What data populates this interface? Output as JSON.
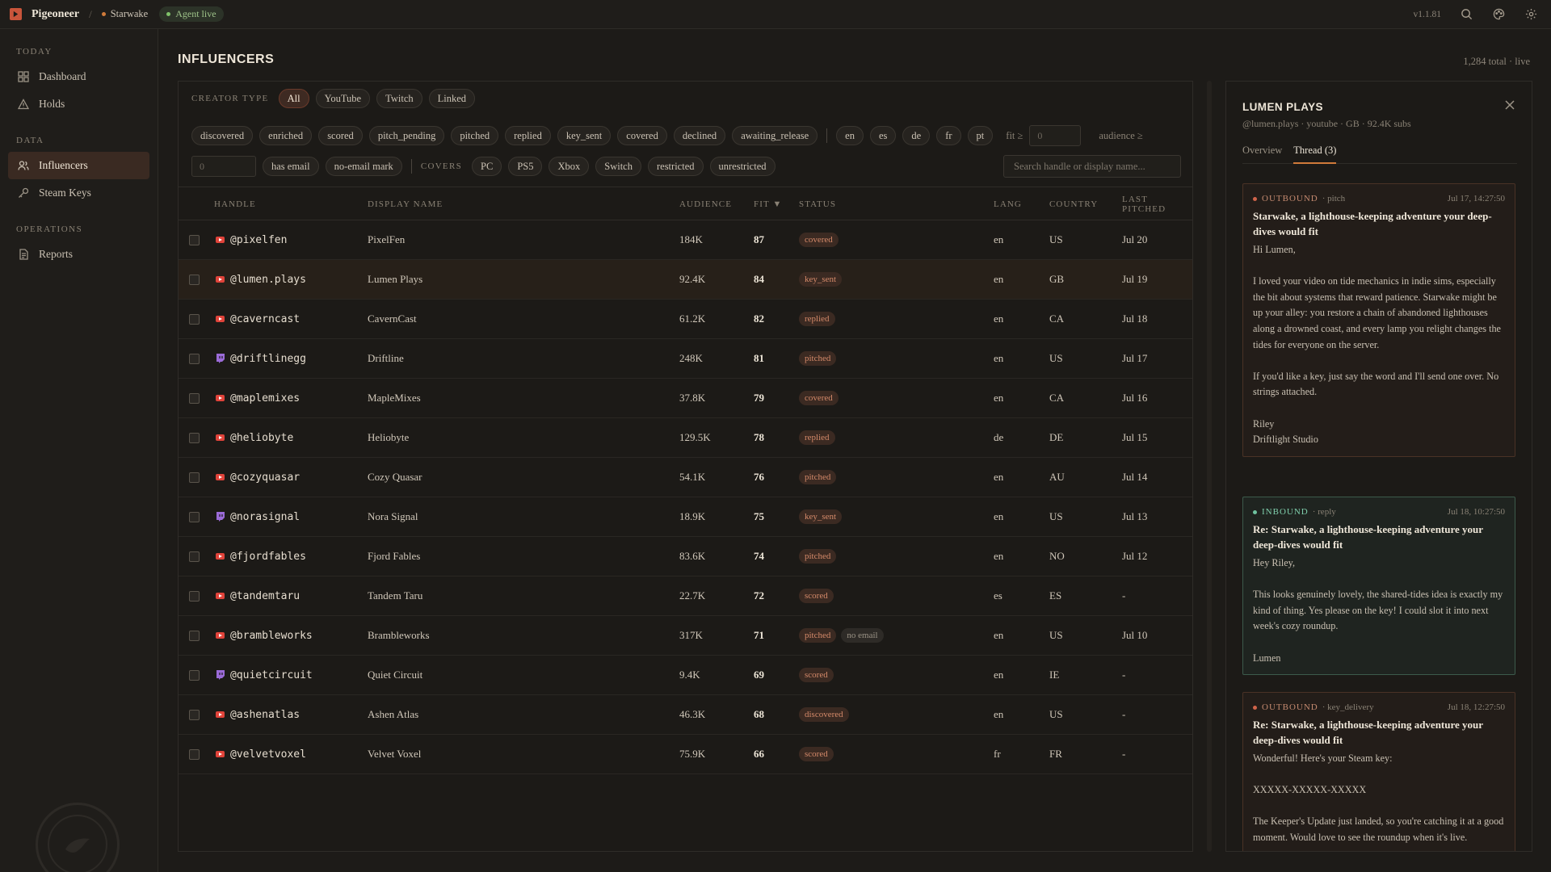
{
  "topbar": {
    "brand": "Pigeoneer",
    "separator": "/",
    "project": "Starwake",
    "agent_status": "Agent live",
    "version": "v1.1.81",
    "colors": {
      "accent": "#c9553b",
      "live": "#7fc26a"
    }
  },
  "sidebar": {
    "sections": [
      {
        "label": "TODAY",
        "items": [
          {
            "label": "Dashboard",
            "icon": "grid-icon"
          },
          {
            "label": "Holds",
            "icon": "warning-icon"
          }
        ]
      },
      {
        "label": "DATA",
        "items": [
          {
            "label": "Influencers",
            "icon": "users-icon",
            "active": true
          },
          {
            "label": "Steam Keys",
            "icon": "key-icon"
          }
        ]
      },
      {
        "label": "OPERATIONS",
        "items": [
          {
            "label": "Reports",
            "icon": "document-icon"
          }
        ]
      }
    ]
  },
  "page": {
    "title": "INFLUENCERS",
    "total": "1,284 total · live"
  },
  "filters": {
    "creator_type_label": "CREATOR TYPE",
    "creator_types": [
      "All",
      "YouTube",
      "Twitch",
      "Linked"
    ],
    "statuses": [
      "discovered",
      "enriched",
      "scored",
      "pitch_pending",
      "pitched",
      "replied",
      "key_sent",
      "covered",
      "declined",
      "awaiting_release"
    ],
    "languages": [
      "en",
      "es",
      "de",
      "fr",
      "pt"
    ],
    "fit_label": "fit ≥",
    "fit_value": "0",
    "audience_label": "audience ≥",
    "audience_value": "0",
    "has_email": "has email",
    "no_email_mark": "no-email mark",
    "covers_label": "COVERS",
    "platforms": [
      "PC",
      "PS5",
      "Xbox",
      "Switch",
      "restricted",
      "unrestricted"
    ],
    "search_placeholder": "Search handle or display name..."
  },
  "table": {
    "headers": {
      "handle": "HANDLE",
      "display": "DISPLAY NAME",
      "audience": "AUDIENCE",
      "fit": "FIT ▼",
      "status": "STATUS",
      "lang": "LANG",
      "country": "COUNTRY",
      "last": "LAST PITCHED"
    },
    "rows": [
      {
        "platform": "youtube",
        "handle": "@pixelfen",
        "display": "PixelFen",
        "audience": "184K",
        "fit": "87",
        "status": "covered",
        "lang": "en",
        "country": "US",
        "last": "Jul 20"
      },
      {
        "platform": "youtube",
        "handle": "@lumen.plays",
        "display": "Lumen Plays",
        "audience": "92.4K",
        "fit": "84",
        "status": "key_sent",
        "lang": "en",
        "country": "GB",
        "last": "Jul 19"
      },
      {
        "platform": "youtube",
        "handle": "@caverncast",
        "display": "CavernCast",
        "audience": "61.2K",
        "fit": "82",
        "status": "replied",
        "lang": "en",
        "country": "CA",
        "last": "Jul 18"
      },
      {
        "platform": "twitch",
        "handle": "@driftlinegg",
        "display": "Driftline",
        "audience": "248K",
        "fit": "81",
        "status": "pitched",
        "lang": "en",
        "country": "US",
        "last": "Jul 17"
      },
      {
        "platform": "youtube",
        "handle": "@maplemixes",
        "display": "MapleMixes",
        "audience": "37.8K",
        "fit": "79",
        "status": "covered",
        "lang": "en",
        "country": "CA",
        "last": "Jul 16"
      },
      {
        "platform": "youtube",
        "handle": "@heliobyte",
        "display": "Heliobyte",
        "audience": "129.5K",
        "fit": "78",
        "status": "replied",
        "lang": "de",
        "country": "DE",
        "last": "Jul 15"
      },
      {
        "platform": "youtube",
        "handle": "@cozyquasar",
        "display": "Cozy Quasar",
        "audience": "54.1K",
        "fit": "76",
        "status": "pitched",
        "lang": "en",
        "country": "AU",
        "last": "Jul 14"
      },
      {
        "platform": "twitch",
        "handle": "@norasignal",
        "display": "Nora Signal",
        "audience": "18.9K",
        "fit": "75",
        "status": "key_sent",
        "lang": "en",
        "country": "US",
        "last": "Jul 13"
      },
      {
        "platform": "youtube",
        "handle": "@fjordfables",
        "display": "Fjord Fables",
        "audience": "83.6K",
        "fit": "74",
        "status": "pitched",
        "lang": "en",
        "country": "NO",
        "last": "Jul 12"
      },
      {
        "platform": "youtube",
        "handle": "@tandemtaru",
        "display": "Tandem Taru",
        "audience": "22.7K",
        "fit": "72",
        "status": "scored",
        "lang": "es",
        "country": "ES",
        "last": "-"
      },
      {
        "platform": "youtube",
        "handle": "@brambleworks",
        "display": "Brambleworks",
        "audience": "317K",
        "fit": "71",
        "status": "pitched",
        "extra": "no email",
        "lang": "en",
        "country": "US",
        "last": "Jul 10"
      },
      {
        "platform": "twitch",
        "handle": "@quietcircuit",
        "display": "Quiet Circuit",
        "audience": "9.4K",
        "fit": "69",
        "status": "scored",
        "lang": "en",
        "country": "IE",
        "last": "-"
      },
      {
        "platform": "youtube",
        "handle": "@ashenatlas",
        "display": "Ashen Atlas",
        "audience": "46.3K",
        "fit": "68",
        "status": "discovered",
        "lang": "en",
        "country": "US",
        "last": "-"
      },
      {
        "platform": "youtube",
        "handle": "@velvetvoxel",
        "display": "Velvet Voxel",
        "audience": "75.9K",
        "fit": "66",
        "status": "scored",
        "lang": "fr",
        "country": "FR",
        "last": "-"
      }
    ]
  },
  "detail": {
    "title": "LUMEN PLAYS",
    "subtitle": "@lumen.plays · youtube · GB · 92.4K subs",
    "tabs": [
      "Overview",
      "Thread (3)"
    ],
    "messages": [
      {
        "direction": "OUTBOUND",
        "kind": "· pitch",
        "time": "Jul 17, 14:27:50",
        "subject": "Starwake, a lighthouse-keeping adventure your deep-dives would fit",
        "body": "Hi Lumen,\n\nI loved your video on tide mechanics in indie sims, especially the bit about systems that reward patience. Starwake might be up your alley: you restore a chain of abandoned lighthouses along a drowned coast, and every lamp you relight changes the tides for everyone on the server.\n\nIf you'd like a key, just say the word and I'll send one over. No strings attached.\n\nRiley\nDriftlight Studio"
      },
      {
        "direction": "INBOUND",
        "kind": "· reply",
        "time": "Jul 18, 10:27:50",
        "subject": "Re: Starwake, a lighthouse-keeping adventure your deep-dives would fit",
        "body": "Hey Riley,\n\nThis looks genuinely lovely, the shared-tides idea is exactly my kind of thing. Yes please on the key! I could slot it into next week's cozy roundup.\n\nLumen"
      },
      {
        "direction": "OUTBOUND",
        "kind": "· key_delivery",
        "time": "Jul 18, 12:27:50",
        "subject": "Re: Starwake, a lighthouse-keeping adventure your deep-dives would fit",
        "body": "Wonderful! Here's your Steam key:\n\nXXXXX-XXXXX-XXXXX\n\nThe Keeper's Update just landed, so you're catching it at a good moment. Would love to see the roundup when it's live."
      }
    ]
  }
}
